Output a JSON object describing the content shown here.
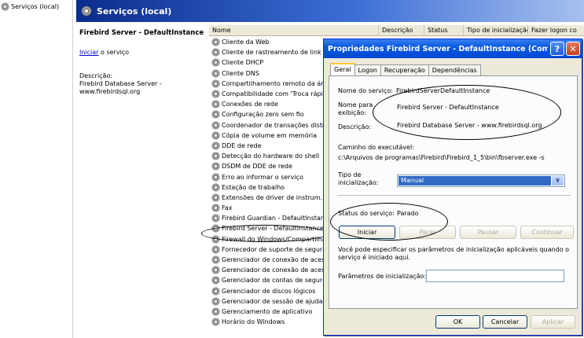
{
  "tree": {
    "label": "Serviços (local)"
  },
  "banner": {
    "title": "Serviços (local)"
  },
  "desc": {
    "title": "Firebird Server - DefaultInstance",
    "action_link": "Iniciar",
    "action_suffix": " o serviço",
    "label": "Descrição:",
    "text": "Firebird Database Server - www.firebirdsql.org"
  },
  "columns": [
    "Nome",
    "Descrição",
    "Status",
    "Tipo de inicialização",
    "Fazer logon co"
  ],
  "services": [
    "Cliente da Web",
    "Cliente de rastreamento de link di",
    "Cliente DHCP",
    "Cliente DNS",
    "Compartilhamento remoto da área",
    "Compatibilidade com 'Troca rápid",
    "Conexões de rede",
    "Configuração zero sem fio",
    "Coordenador de transações distri",
    "Cópia de volume em memória",
    "DDE de rede",
    "Detecção do hardware do shell",
    "DSDM de DDE de rede",
    "Erro ao informar o serviço",
    "Estação de trabalho",
    "Extensões de driver de instrum.",
    "Fax",
    "Firebird Guardian - DefaultInstanc",
    "Firebird Server - DefaultInstance",
    "Firewall do Windows/Compartilham",
    "Fornecedor de suporte de segura",
    "Gerenciador de conexão de acess",
    "Gerenciador de conexão de acess",
    "Gerenciador de contas de segurar",
    "Gerenciador de discos lógicos",
    "Gerenciador de sessão de ajuda d",
    "Gerenciamento de aplicativo",
    "Horário do Windows"
  ],
  "dialog": {
    "title": "Propriedades Firebird Server - DefaultInstance (Comp...",
    "help_glyph": "?",
    "close_glyph": "✕",
    "tabs": [
      "Geral",
      "Logon",
      "Recuperação",
      "Dependências"
    ],
    "service_name_label": "Nome do serviço:",
    "service_name": "FirebirdServerDefaultInstance",
    "display_name_label": "Nome para exibição:",
    "display_name": "Firebird Server - DefaultInstance",
    "description_label": "Descrição:",
    "description": "Firebird Database Server - www.firebirdsql.org",
    "exe_path_label": "Caminho do executável:",
    "exe_path": "c:\\Arquivos de programas\\Firebird\\Firebird_1_5\\bin\\fbserver.exe -s",
    "startup_type_label": "Tipo de inicialização:",
    "startup_type": "Manual",
    "status_label": "Status do serviço:",
    "status": "Parado",
    "btn_start": "Iniciar",
    "btn_stop": "Parar",
    "btn_pause": "Pausar",
    "btn_continue": "Continuar",
    "hint": "Você pode especificar os parâmetros de inicialização aplicáveis quando o serviço é iniciado aqui.",
    "params_label": "Parâmetros de inicialização:",
    "params_value": "",
    "btn_ok": "OK",
    "btn_cancel": "Cancelar",
    "btn_apply": "Aplicar"
  }
}
